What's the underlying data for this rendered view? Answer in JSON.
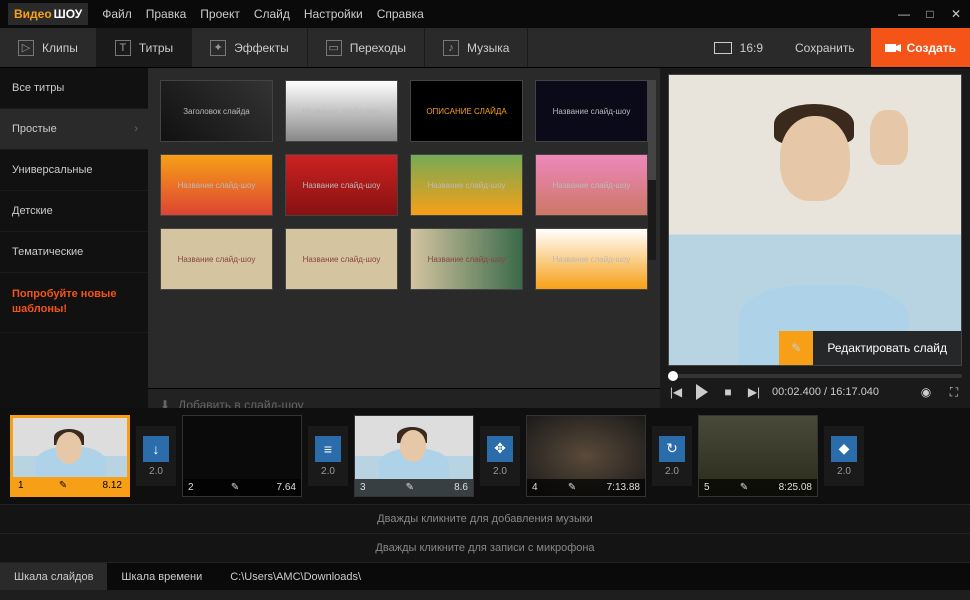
{
  "app": {
    "logo_a": "Видео",
    "logo_b": "ШОУ"
  },
  "menu": [
    "Файл",
    "Правка",
    "Проект",
    "Слайд",
    "Настройки",
    "Справка"
  ],
  "tabs": [
    {
      "label": "Клипы",
      "icon": "▷"
    },
    {
      "label": "Титры",
      "icon": "T"
    },
    {
      "label": "Эффекты",
      "icon": "✦"
    },
    {
      "label": "Переходы",
      "icon": "▭"
    },
    {
      "label": "Музыка",
      "icon": "♪"
    }
  ],
  "active_tab": 1,
  "aspect": "16:9",
  "save_label": "Сохранить",
  "create_label": "Создать",
  "sidebar": {
    "items": [
      "Все титры",
      "Простые",
      "Универсальные",
      "Детские",
      "Тематические"
    ],
    "active": 1,
    "promo": "Попробуйте новые шаблоны!"
  },
  "gallery_thumbs": [
    "Заголовок слайда",
    "Название слайд-шоу",
    "ОПИСАНИЕ СЛАЙДА",
    "Название слайд-шоу",
    "Название слайд-шоу",
    "Название слайд-шоу",
    "Название слайд-шоу",
    "Название слайд-шоу",
    "Название слайд-шоу",
    "Название слайд-шоу",
    "Название слайд-шоу",
    "Название слайд-шоу"
  ],
  "add_to_show": "Добавить в слайд-шоу",
  "edit_slide": "Редактировать слайд",
  "playback": {
    "current": "00:02.400",
    "total": "16:17.040",
    "sep": " / "
  },
  "clips": [
    {
      "n": "1",
      "dur": "8.12",
      "kind": "man"
    },
    {
      "n": "2",
      "dur": "7.64",
      "kind": "dark"
    },
    {
      "n": "3",
      "dur": "8.6",
      "kind": "man"
    },
    {
      "n": "4",
      "dur": "7:13.88",
      "kind": "scene"
    },
    {
      "n": "5",
      "dur": "8:25.08",
      "kind": "mech"
    }
  ],
  "transitions": [
    {
      "t": "2.0",
      "icon": "↓"
    },
    {
      "t": "2.0",
      "icon": "≡"
    },
    {
      "t": "2.0",
      "icon": "✥"
    },
    {
      "t": "2.0",
      "icon": "↻"
    },
    {
      "t": "2.0",
      "icon": "◆"
    }
  ],
  "hints": {
    "music": "Дважды кликните для добавления музыки",
    "mic": "Дважды кликните для записи с микрофона"
  },
  "status": {
    "slides_tab": "Шкала слайдов",
    "time_tab": "Шкала времени",
    "path": "C:\\Users\\AMC\\Downloads\\"
  }
}
